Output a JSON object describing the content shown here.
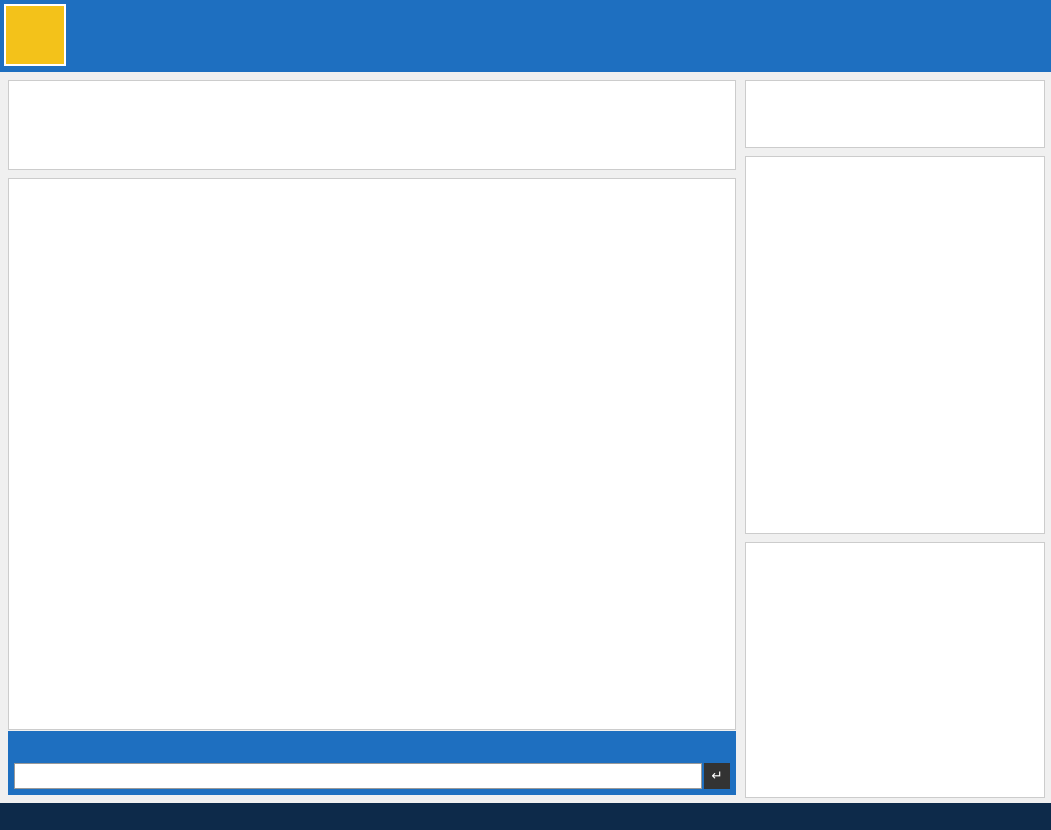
{
  "topbar": {
    "stats_text": "",
    "room_info_text": "",
    "leave_label": ""
  },
  "chat": {
    "messages": []
  },
  "toolbar": {
    "items": []
  },
  "input": {
    "placeholder": ""
  },
  "result": {
    "title": ""
  },
  "userpanel": {
    "tab_users": "",
    "tab_info": "",
    "users": []
  },
  "footer": {
    "copyright": ""
  }
}
